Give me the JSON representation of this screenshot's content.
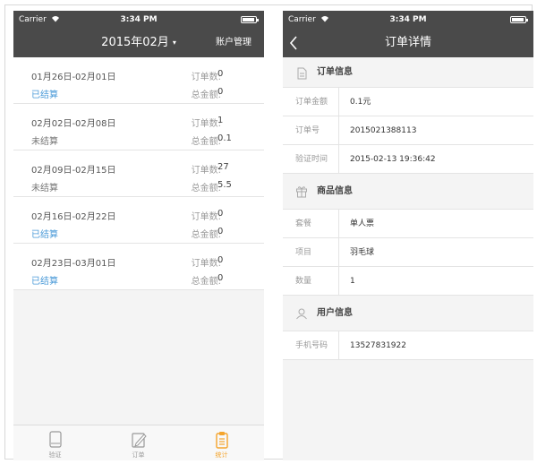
{
  "status_bar": {
    "carrier": "Carrier",
    "wifi_icon": "wifi-icon",
    "time": "3:34 PM"
  },
  "left_screen": {
    "title": "2015年02月",
    "title_caret": "▾",
    "account_manage": "账户管理",
    "weeks": [
      {
        "range": "01月26日-02月01日",
        "status": "已结算",
        "settled": true,
        "orders_label": "订单数:",
        "orders": "0",
        "total_label": "总金额:",
        "total": "0"
      },
      {
        "range": "02月02日-02月08日",
        "status": "未结算",
        "settled": false,
        "orders_label": "订单数:",
        "orders": "1",
        "total_label": "总金额:",
        "total": "0.1"
      },
      {
        "range": "02月09日-02月15日",
        "status": "未结算",
        "settled": false,
        "orders_label": "订单数:",
        "orders": "27",
        "total_label": "总金额:",
        "total": "5.5"
      },
      {
        "range": "02月16日-02月22日",
        "status": "已结算",
        "settled": true,
        "orders_label": "订单数:",
        "orders": "0",
        "total_label": "总金额:",
        "total": "0"
      },
      {
        "range": "02月23日-03月01日",
        "status": "已结算",
        "settled": true,
        "orders_label": "订单数:",
        "orders": "0",
        "total_label": "总金额:",
        "total": "0"
      }
    ],
    "tabs": [
      {
        "label": "验证",
        "icon": "tablet-icon",
        "active": false
      },
      {
        "label": "订单",
        "icon": "pencil-icon",
        "active": false
      },
      {
        "label": "统计",
        "icon": "clipboard-icon",
        "active": true
      }
    ],
    "colors": {
      "settled": "#4a9ad8",
      "tab_active": "#f4a42c",
      "navbar": "#4a4a4a"
    }
  },
  "right_screen": {
    "back_icon": "chevron-left-icon",
    "title": "订单详情",
    "sections": [
      {
        "title": "订单信息",
        "icon": "document-icon",
        "rows": [
          {
            "label": "订单金额",
            "value": "0.1元"
          },
          {
            "label": "订单号",
            "value": "2015021388113"
          },
          {
            "label": "验证时间",
            "value": "2015-02-13  19:36:42"
          }
        ]
      },
      {
        "title": "商品信息",
        "icon": "gift-icon",
        "rows": [
          {
            "label": "套餐",
            "value": "单人票"
          },
          {
            "label": "项目",
            "value": "羽毛球"
          },
          {
            "label": "数量",
            "value": "1"
          }
        ]
      },
      {
        "title": "用户信息",
        "icon": "user-icon",
        "rows": [
          {
            "label": "手机号码",
            "value": "13527831922"
          }
        ]
      }
    ]
  }
}
